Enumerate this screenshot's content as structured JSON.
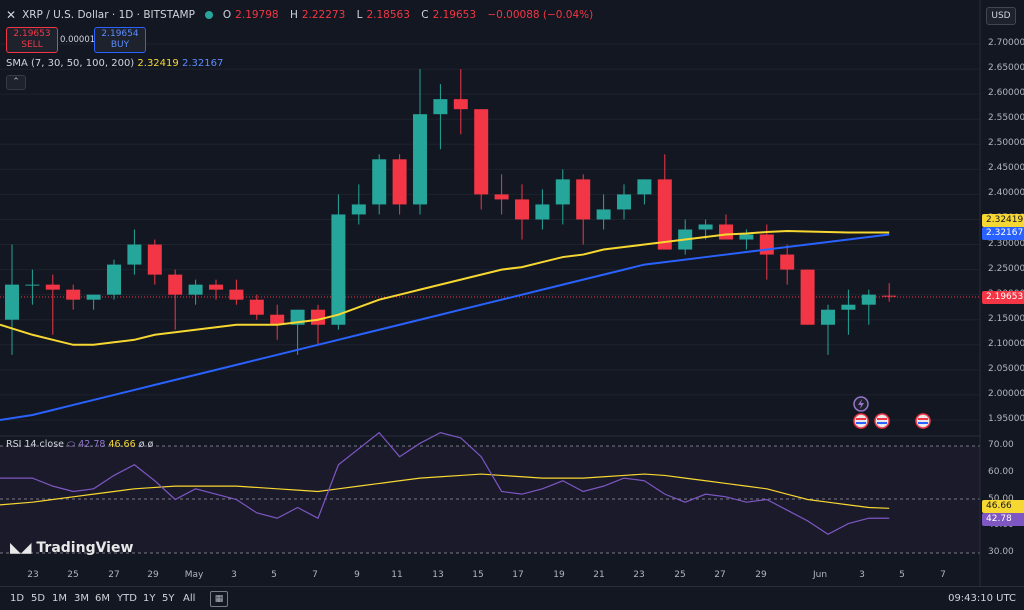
{
  "header": {
    "symbol": "XRP / U.S. Dollar · 1D · BITSTAMP",
    "o_label": "O",
    "o": "2.19798",
    "h_label": "H",
    "h": "2.22273",
    "l_label": "L",
    "l": "2.18563",
    "c_label": "C",
    "c": "2.19653",
    "change": "−0.00088 (−0.04%)"
  },
  "trade": {
    "sell_price": "2.19653",
    "sell_label": "SELL",
    "buy_price": "2.19654",
    "buy_label": "BUY",
    "spread": "0.00001"
  },
  "sma": {
    "label": "SMA (7, 30, 50, 100, 200)",
    "v1": "2.32419",
    "v2": "2.32167"
  },
  "currency": "USD",
  "rsi": {
    "label": "RSI 14 close",
    "v1": "42.78",
    "v2": "46.66",
    "extra": "ø ø"
  },
  "price_axis": [
    "2.70000",
    "2.65000",
    "2.60000",
    "2.55000",
    "2.50000",
    "2.45000",
    "2.40000",
    "2.35000",
    "2.30000",
    "2.25000",
    "2.20000",
    "2.15000",
    "2.10000",
    "2.05000",
    "2.00000",
    "1.95000"
  ],
  "price_tags": {
    "sma1": "2.32419",
    "sma2": "2.32167",
    "last": "2.19653"
  },
  "rsi_axis": [
    "70.00",
    "60.00",
    "50.00",
    "40.00",
    "30.00"
  ],
  "rsi_tags": {
    "a": "46.66",
    "b": "42.78"
  },
  "time_axis": [
    "23",
    "25",
    "27",
    "29",
    "May",
    "3",
    "5",
    "7",
    "9",
    "11",
    "13",
    "15",
    "17",
    "19",
    "21",
    "23",
    "25",
    "27",
    "29",
    "Jun",
    "3",
    "5",
    "7"
  ],
  "watermark": "TradingView",
  "timeframes": [
    "1D",
    "5D",
    "1M",
    "3M",
    "6M",
    "YTD",
    "1Y",
    "5Y",
    "All"
  ],
  "clock": "09:43:10 UTC",
  "colors": {
    "up": "#26a69a",
    "down": "#f23645",
    "sma_fast": "#f7d731",
    "sma_slow": "#2962ff",
    "rsi": "#7e57c2"
  },
  "chart_data": {
    "type": "candlestick",
    "candles": [
      {
        "o": 2.15,
        "h": 2.3,
        "l": 2.08,
        "c": 2.22
      },
      {
        "o": 2.22,
        "h": 2.25,
        "l": 2.18,
        "c": 2.22
      },
      {
        "o": 2.22,
        "h": 2.24,
        "l": 2.12,
        "c": 2.21
      },
      {
        "o": 2.21,
        "h": 2.22,
        "l": 2.17,
        "c": 2.19
      },
      {
        "o": 2.19,
        "h": 2.2,
        "l": 2.17,
        "c": 2.2
      },
      {
        "o": 2.2,
        "h": 2.27,
        "l": 2.19,
        "c": 2.26
      },
      {
        "o": 2.26,
        "h": 2.33,
        "l": 2.24,
        "c": 2.3
      },
      {
        "o": 2.3,
        "h": 2.31,
        "l": 2.22,
        "c": 2.24
      },
      {
        "o": 2.24,
        "h": 2.25,
        "l": 2.13,
        "c": 2.2
      },
      {
        "o": 2.2,
        "h": 2.23,
        "l": 2.18,
        "c": 2.22
      },
      {
        "o": 2.22,
        "h": 2.23,
        "l": 2.19,
        "c": 2.21
      },
      {
        "o": 2.21,
        "h": 2.23,
        "l": 2.18,
        "c": 2.19
      },
      {
        "o": 2.19,
        "h": 2.2,
        "l": 2.15,
        "c": 2.16
      },
      {
        "o": 2.16,
        "h": 2.18,
        "l": 2.11,
        "c": 2.14
      },
      {
        "o": 2.14,
        "h": 2.17,
        "l": 2.08,
        "c": 2.17
      },
      {
        "o": 2.17,
        "h": 2.18,
        "l": 2.1,
        "c": 2.14
      },
      {
        "o": 2.14,
        "h": 2.4,
        "l": 2.13,
        "c": 2.36
      },
      {
        "o": 2.36,
        "h": 2.42,
        "l": 2.34,
        "c": 2.38
      },
      {
        "o": 2.38,
        "h": 2.48,
        "l": 2.36,
        "c": 2.47
      },
      {
        "o": 2.47,
        "h": 2.48,
        "l": 2.36,
        "c": 2.38
      },
      {
        "o": 2.38,
        "h": 2.65,
        "l": 2.36,
        "c": 2.56
      },
      {
        "o": 2.56,
        "h": 2.62,
        "l": 2.49,
        "c": 2.59
      },
      {
        "o": 2.59,
        "h": 2.65,
        "l": 2.52,
        "c": 2.57
      },
      {
        "o": 2.57,
        "h": 2.57,
        "l": 2.37,
        "c": 2.4
      },
      {
        "o": 2.4,
        "h": 2.44,
        "l": 2.36,
        "c": 2.39
      },
      {
        "o": 2.39,
        "h": 2.42,
        "l": 2.31,
        "c": 2.35
      },
      {
        "o": 2.35,
        "h": 2.41,
        "l": 2.33,
        "c": 2.38
      },
      {
        "o": 2.38,
        "h": 2.45,
        "l": 2.34,
        "c": 2.43
      },
      {
        "o": 2.43,
        "h": 2.44,
        "l": 2.3,
        "c": 2.35
      },
      {
        "o": 2.35,
        "h": 2.4,
        "l": 2.33,
        "c": 2.37
      },
      {
        "o": 2.37,
        "h": 2.42,
        "l": 2.35,
        "c": 2.4
      },
      {
        "o": 2.4,
        "h": 2.43,
        "l": 2.38,
        "c": 2.43
      },
      {
        "o": 2.43,
        "h": 2.48,
        "l": 2.29,
        "c": 2.29
      },
      {
        "o": 2.29,
        "h": 2.35,
        "l": 2.28,
        "c": 2.33
      },
      {
        "o": 2.33,
        "h": 2.35,
        "l": 2.31,
        "c": 2.34
      },
      {
        "o": 2.34,
        "h": 2.36,
        "l": 2.31,
        "c": 2.31
      },
      {
        "o": 2.31,
        "h": 2.33,
        "l": 2.29,
        "c": 2.32
      },
      {
        "o": 2.32,
        "h": 2.34,
        "l": 2.23,
        "c": 2.28
      },
      {
        "o": 2.28,
        "h": 2.3,
        "l": 2.22,
        "c": 2.25
      },
      {
        "o": 2.25,
        "h": 2.25,
        "l": 2.14,
        "c": 2.14
      },
      {
        "o": 2.14,
        "h": 2.18,
        "l": 2.08,
        "c": 2.17
      },
      {
        "o": 2.17,
        "h": 2.21,
        "l": 2.12,
        "c": 2.18
      },
      {
        "o": 2.18,
        "h": 2.21,
        "l": 2.14,
        "c": 2.2
      },
      {
        "o": 2.198,
        "h": 2.223,
        "l": 2.186,
        "c": 2.197
      }
    ],
    "sma_fast": [
      2.14,
      2.12,
      2.11,
      2.1,
      2.1,
      2.105,
      2.11,
      2.12,
      2.125,
      2.13,
      2.135,
      2.14,
      2.14,
      2.14,
      2.145,
      2.15,
      2.16,
      2.175,
      2.19,
      2.2,
      2.21,
      2.22,
      2.23,
      2.24,
      2.25,
      2.255,
      2.265,
      2.275,
      2.28,
      2.29,
      2.295,
      2.3,
      2.305,
      2.31,
      2.315,
      2.32,
      2.322,
      2.325,
      2.327,
      2.326,
      2.325,
      2.324,
      2.324,
      2.324
    ],
    "sma_slow": [
      1.95,
      1.96,
      1.97,
      1.98,
      1.99,
      2.0,
      2.01,
      2.02,
      2.03,
      2.04,
      2.05,
      2.06,
      2.07,
      2.08,
      2.09,
      2.1,
      2.11,
      2.12,
      2.13,
      2.14,
      2.15,
      2.16,
      2.17,
      2.18,
      2.19,
      2.2,
      2.21,
      2.22,
      2.23,
      2.24,
      2.25,
      2.26,
      2.265,
      2.27,
      2.275,
      2.28,
      2.285,
      2.29,
      2.295,
      2.3,
      2.305,
      2.31,
      2.315,
      2.32
    ],
    "rsi": [
      58,
      58,
      55,
      53,
      54,
      59,
      63,
      57,
      50,
      54,
      52,
      50,
      45,
      43,
      47,
      43,
      63,
      69,
      75,
      66,
      71,
      75,
      73,
      66,
      53,
      52,
      54,
      57,
      53,
      55,
      58,
      57,
      52,
      49,
      52,
      51,
      49,
      50,
      46,
      42,
      37,
      41,
      43,
      43
    ],
    "rsi_ma": [
      48,
      49,
      50,
      51,
      52,
      53,
      54,
      54.5,
      55,
      55,
      55,
      55,
      54.5,
      54,
      53.5,
      53,
      54,
      55,
      56,
      57,
      58,
      58.5,
      59,
      59.5,
      59,
      58.5,
      58,
      58,
      58,
      58.5,
      59,
      59.5,
      59,
      58,
      57,
      56,
      55,
      54,
      52,
      50,
      49,
      48,
      47,
      46.7
    ],
    "ylim": [
      1.93,
      2.72
    ],
    "rsi_lim": [
      26,
      74
    ]
  }
}
